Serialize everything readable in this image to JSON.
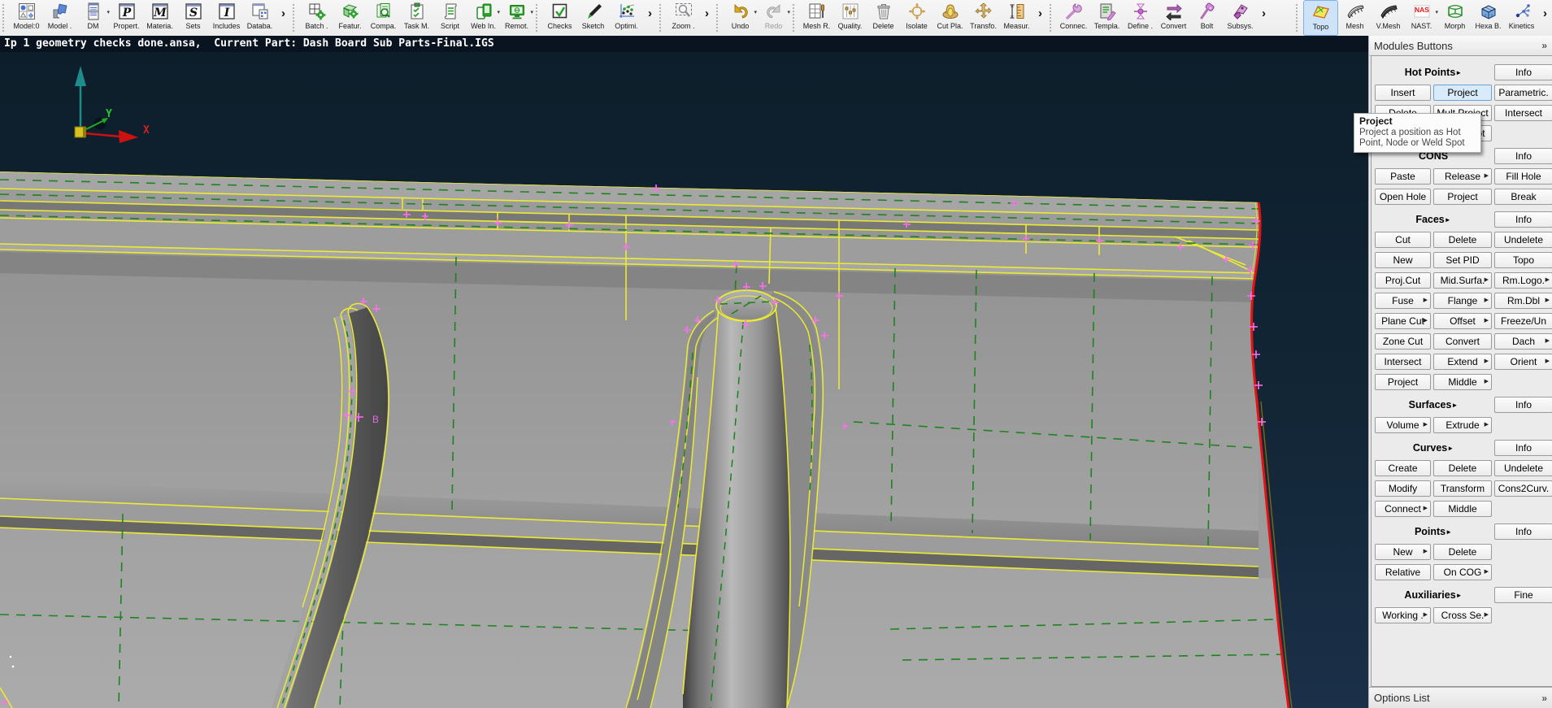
{
  "toolbar": {
    "groups": [
      {
        "expand": true,
        "items": [
          {
            "label": "Model:0",
            "icon": "model0"
          },
          {
            "label": "Model .",
            "icon": "model"
          },
          {
            "label": "DM",
            "icon": "dm",
            "caret": true
          },
          {
            "label": "Propert.",
            "icon": "letterP"
          },
          {
            "label": "Materia.",
            "icon": "letterM"
          },
          {
            "label": "Sets",
            "icon": "letterS"
          },
          {
            "label": "Includes",
            "icon": "letterI"
          },
          {
            "label": "Databa.",
            "icon": "dbwin"
          }
        ]
      },
      {
        "expand": false,
        "items": [
          {
            "label": "Batch .",
            "icon": "batch"
          },
          {
            "label": "Featur.",
            "icon": "featur"
          },
          {
            "label": "Compa.",
            "icon": "compare"
          },
          {
            "label": "Task M.",
            "icon": "taskm"
          },
          {
            "label": "Script",
            "icon": "script"
          },
          {
            "label": "Web In.",
            "icon": "webin",
            "caret": true
          },
          {
            "label": "Remot.",
            "icon": "remote",
            "caret": true
          }
        ]
      },
      {
        "expand": true,
        "items": [
          {
            "label": "Checks",
            "icon": "checks"
          },
          {
            "label": "Sketch",
            "icon": "sketch"
          },
          {
            "label": "Optimi.",
            "icon": "optimi"
          }
        ]
      },
      {
        "expand": true,
        "items": [
          {
            "label": "Zoom .",
            "icon": "zoomtool"
          }
        ]
      },
      {
        "expand": false,
        "items": [
          {
            "label": "Undo",
            "icon": "undo",
            "caret": true
          },
          {
            "label": "Redo",
            "icon": "redo",
            "caret": true,
            "disabled": true
          }
        ]
      },
      {
        "expand": true,
        "items": [
          {
            "label": "Mesh R.",
            "icon": "meshr"
          },
          {
            "label": "Quality.",
            "icon": "quality"
          },
          {
            "label": "Delete",
            "icon": "trash"
          },
          {
            "label": "Isolate",
            "icon": "isolate"
          },
          {
            "label": "Cut Pla.",
            "icon": "cutplane"
          },
          {
            "label": "Transfo.",
            "icon": "transform"
          },
          {
            "label": "Measur.",
            "icon": "measure"
          }
        ]
      },
      {
        "expand": true,
        "items": [
          {
            "label": "Connec.",
            "icon": "connect"
          },
          {
            "label": "Templa.",
            "icon": "template"
          },
          {
            "label": "Define .",
            "icon": "define"
          },
          {
            "label": "Convert",
            "icon": "convert"
          },
          {
            "label": "Bolt",
            "icon": "bolt"
          },
          {
            "label": "Subsys.",
            "icon": "subsys"
          }
        ]
      },
      {
        "expand": true,
        "push_right": true,
        "items": [
          {
            "label": "Topo",
            "icon": "topo",
            "selected": true
          },
          {
            "label": "Mesh",
            "icon": "meshpatch"
          },
          {
            "label": "V.Mesh",
            "icon": "vmesh"
          },
          {
            "label": "NAST.",
            "icon": "nast",
            "caret": true
          },
          {
            "label": "Morph",
            "icon": "morph"
          },
          {
            "label": "Hexa B.",
            "icon": "hexab"
          },
          {
            "label": "Kinetics",
            "icon": "kinetics"
          }
        ]
      }
    ]
  },
  "status_bar": {
    "text": "Ip 1 geometry checks done.ansa,  Current Part: Dash Board Sub Parts-Final.IGS"
  },
  "viewport": {
    "axis": {
      "x": "X",
      "y": "Y"
    },
    "labels": {
      "point_b": "B"
    }
  },
  "tooltip": {
    "title": "Project",
    "body1": "Project a position as Hot",
    "body2": "Point, Node or Weld Spot"
  },
  "sidebar": {
    "title": "Modules Buttons",
    "collapse_icon": "»",
    "sections": [
      {
        "title": "Hot Points",
        "arrow": true,
        "info": "Info",
        "rows": [
          [
            {
              "t": "Insert"
            },
            {
              "t": "Project",
              "active": true
            },
            {
              "t": "Parametric."
            }
          ],
          [
            {
              "t": "Delete"
            },
            {
              "t": "Mult.Project"
            },
            {
              "t": "Intersect"
            }
          ],
          [
            null,
            {
              "t": "Weld Spot"
            },
            null
          ]
        ]
      },
      {
        "title": "CONS",
        "arrow": false,
        "info": "Info",
        "rows": [
          [
            {
              "t": "Paste"
            },
            {
              "t": "Release",
              "sub": true
            },
            {
              "t": "Fill Hole"
            }
          ],
          [
            {
              "t": "Open Hole"
            },
            {
              "t": "Project"
            },
            {
              "t": "Break"
            }
          ]
        ]
      },
      {
        "title": "Faces",
        "arrow": true,
        "info": "Info",
        "rows": [
          [
            {
              "t": "Cut"
            },
            {
              "t": "Delete"
            },
            {
              "t": "Undelete"
            }
          ],
          [
            {
              "t": "New"
            },
            {
              "t": "Set PID"
            },
            {
              "t": "Topo"
            }
          ],
          [
            {
              "t": "Proj.Cut"
            },
            {
              "t": "Mid.Surfa.",
              "sub": true
            },
            {
              "t": "Rm.Logo.",
              "sub": true
            }
          ],
          [
            {
              "t": "Fuse",
              "sub": true
            },
            {
              "t": "Flange",
              "sub": true
            },
            {
              "t": "Rm.Dbl",
              "sub": true
            }
          ],
          [
            {
              "t": "Plane Cut",
              "sub": true
            },
            {
              "t": "Offset",
              "sub": true
            },
            {
              "t": "Freeze/Un"
            }
          ],
          [
            {
              "t": "Zone Cut"
            },
            {
              "t": "Convert"
            },
            {
              "t": "Dach",
              "sub": true
            }
          ],
          [
            {
              "t": "Intersect"
            },
            {
              "t": "Extend",
              "sub": true
            },
            {
              "t": "Orient",
              "sub": true
            }
          ],
          [
            {
              "t": "Project"
            },
            {
              "t": "Middle",
              "sub": true
            },
            null
          ]
        ]
      },
      {
        "title": "Surfaces",
        "arrow": true,
        "info": "Info",
        "rows": [
          [
            {
              "t": "Volume",
              "sub": true
            },
            {
              "t": "Extrude",
              "sub": true
            },
            null
          ]
        ]
      },
      {
        "title": "Curves",
        "arrow": true,
        "info": "Info",
        "rows": [
          [
            {
              "t": "Create"
            },
            {
              "t": "Delete"
            },
            {
              "t": "Undelete"
            }
          ],
          [
            {
              "t": "Modify"
            },
            {
              "t": "Transform"
            },
            {
              "t": "Cons2Curv."
            }
          ],
          [
            {
              "t": "Connect",
              "sub": true
            },
            {
              "t": "Middle"
            },
            null
          ]
        ]
      },
      {
        "title": "Points",
        "arrow": true,
        "info": "Info",
        "rows": [
          [
            {
              "t": "New",
              "sub": true
            },
            {
              "t": "Delete"
            },
            null
          ],
          [
            {
              "t": "Relative"
            },
            {
              "t": "On COG",
              "sub": true
            },
            null
          ]
        ]
      },
      {
        "title": "Auxiliaries",
        "arrow": true,
        "info": "Fine",
        "rows": [
          [
            {
              "t": "Working .",
              "sub": true
            },
            {
              "t": "Cross Se.",
              "sub": true
            },
            null
          ]
        ]
      }
    ],
    "options_list": {
      "title": "Options List",
      "collapse_icon": "»"
    }
  }
}
